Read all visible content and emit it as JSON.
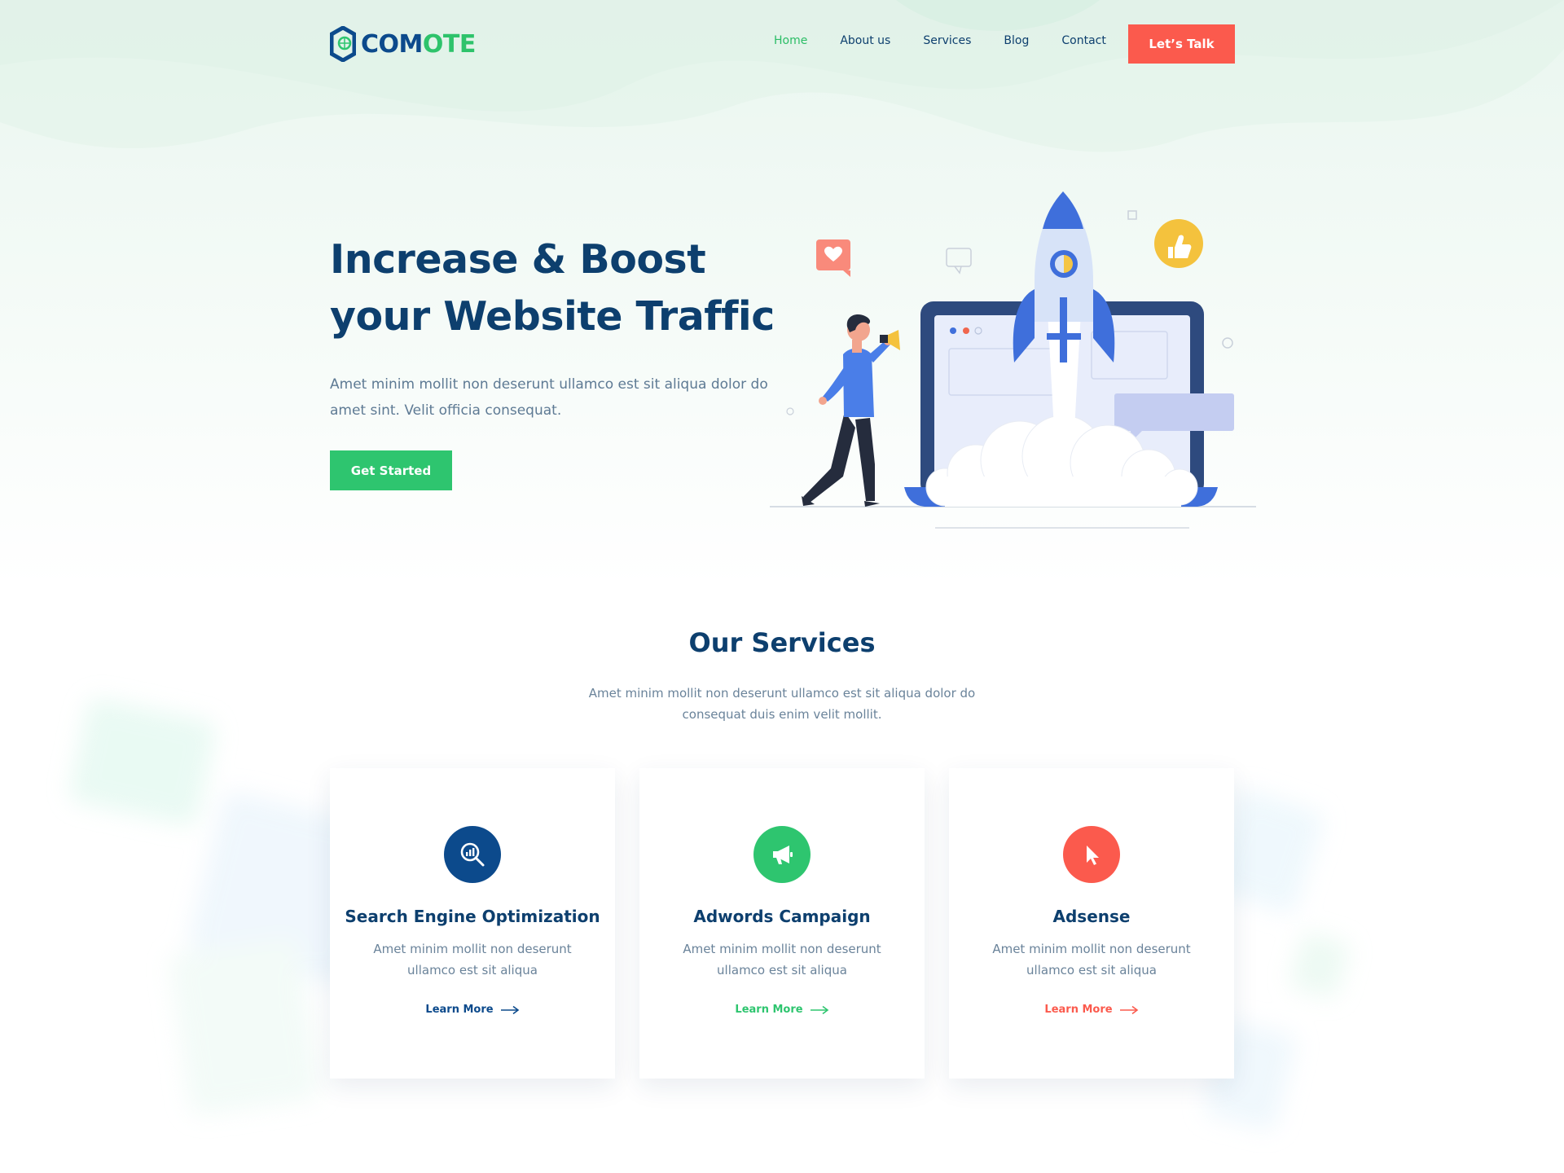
{
  "header": {
    "logo_text_primary": "COM",
    "logo_text_secondary": "OTE",
    "nav": [
      {
        "label": "Home",
        "active": true
      },
      {
        "label": "About us",
        "active": false
      },
      {
        "label": "Services",
        "active": false
      },
      {
        "label": "Blog",
        "active": false
      },
      {
        "label": "Contact",
        "active": false
      }
    ],
    "cta_label": "Let’s Talk"
  },
  "hero": {
    "title_line1": "Increase & Boost",
    "title_line2": "your Website Traffic",
    "desc_line1": "Amet minim mollit non deserunt ullamco est sit aliqua dolor do",
    "desc_line2": "amet sint. Velit officia consequat.",
    "button_label": "Get Started"
  },
  "services": {
    "title": "Our Services",
    "desc_line1": "Amet minim mollit non deserunt ullamco est sit aliqua dolor do",
    "desc_line2": "consequat duis enim velit mollit.",
    "cards": [
      {
        "title": "Search Engine Optimization",
        "desc_line1": "Amet minim mollit non deserunt",
        "desc_line2": "ullamco est sit aliqua",
        "link": "Learn More",
        "icon": "seo-search-icon",
        "color": "#0c4a8c"
      },
      {
        "title": "Adwords Campaign",
        "desc_line1": "Amet minim mollit non deserunt",
        "desc_line2": "ullamco est sit aliqua",
        "link": "Learn More",
        "icon": "megaphone-icon",
        "color": "#2ec56f"
      },
      {
        "title": "Adsense",
        "desc_line1": "Amet minim mollit non deserunt",
        "desc_line2": "ullamco est sit aliqua",
        "link": "Learn More",
        "icon": "cursor-icon",
        "color": "#fb5a4d"
      }
    ]
  },
  "colors": {
    "navy": "#0d3f6e",
    "green": "#2ec56f",
    "coral": "#fb5a4d"
  }
}
